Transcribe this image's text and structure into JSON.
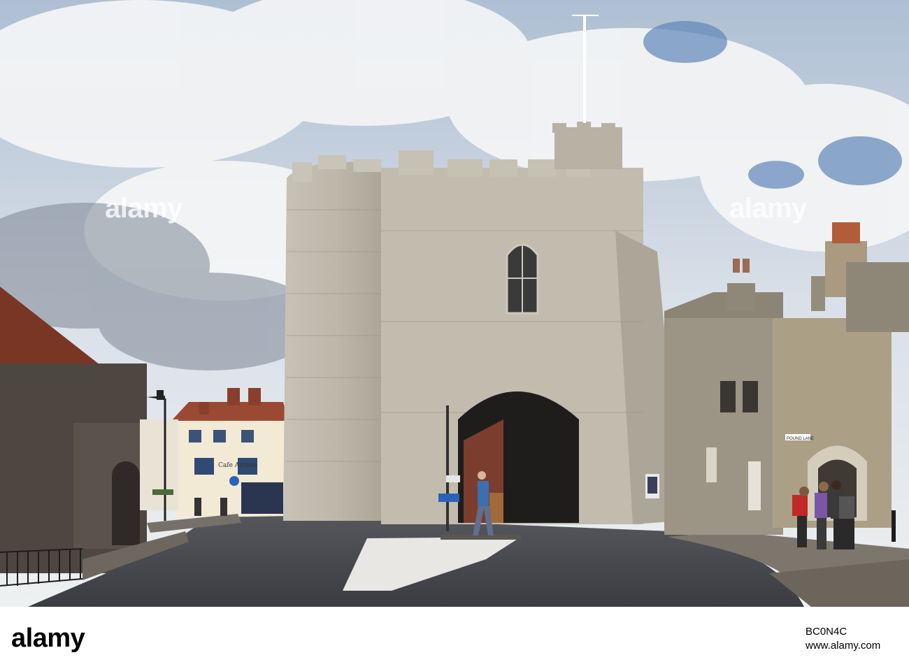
{
  "watermark": "alamy",
  "shop_sign": "Cafe Amano",
  "street_sign": "POUND LANE",
  "footer": {
    "logo": "alamy",
    "image_id": "BC0N4C",
    "url": "www.alamy.com"
  },
  "colors": {
    "sky": "#c9d7e6",
    "stone": "#b9b3a6",
    "road": "#3e4046",
    "roof": "#8a3f2c"
  }
}
